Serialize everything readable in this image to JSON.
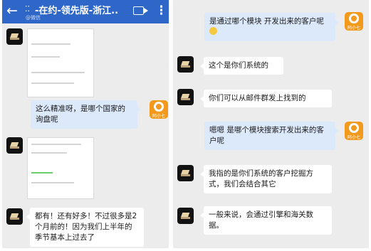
{
  "header": {
    "title": "-在约-领先版-浙江...",
    "subtitle": "@微信",
    "back_icon": "arrow-left-icon",
    "video_icon": "video-call-icon",
    "more_icon": "more-vertical-icon",
    "bar_color": "#2f67c9"
  },
  "left_messages": [
    {
      "from": "contact",
      "type": "image"
    },
    {
      "from": "me",
      "type": "text",
      "text": "这么精准呀，是哪个国家的询盘呢"
    },
    {
      "from": "contact",
      "type": "image"
    },
    {
      "from": "contact",
      "type": "text",
      "text": "都有！还有好多！不过很多是2个月前的！因为我们上半年的季节基本上过去了"
    }
  ],
  "right_messages": [
    {
      "from": "me",
      "type": "text",
      "text": "是通过哪个模块 开发出来的客户呢",
      "emoji": "grinning-face-emoji"
    },
    {
      "from": "contact",
      "type": "text",
      "text": "这个是你们系统的"
    },
    {
      "from": "contact",
      "type": "text",
      "text": "你们可以从邮件群发上找到的"
    },
    {
      "from": "me",
      "type": "text",
      "text": "嗯嗯 是哪个模块搜索开发出来的客户呢"
    },
    {
      "from": "contact",
      "type": "text",
      "text": "我指的是你们系统的客户挖掘方式，我们会结合其它"
    },
    {
      "from": "contact",
      "type": "text",
      "text": "一般来说，会通过引擎和海关数据。"
    }
  ],
  "avatars": {
    "me_label": "阿小七",
    "me_color": "#f39a1d",
    "contact_color": "#121212"
  },
  "colors": {
    "chat_bg": "#ececec",
    "bubble_out": "#dce9fb",
    "bubble_in": "#ffffff"
  }
}
